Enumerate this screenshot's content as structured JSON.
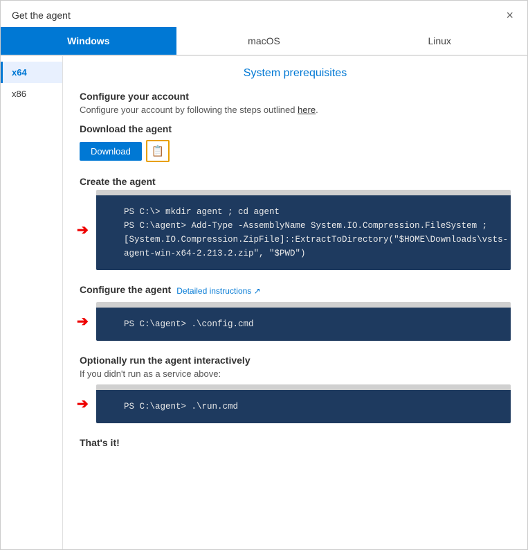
{
  "dialog": {
    "title": "Get the agent",
    "close_label": "×"
  },
  "tabs": [
    {
      "id": "windows",
      "label": "Windows",
      "active": true
    },
    {
      "id": "macos",
      "label": "macOS",
      "active": false
    },
    {
      "id": "linux",
      "label": "Linux",
      "active": false
    }
  ],
  "sidebar": {
    "items": [
      {
        "id": "x64",
        "label": "x64",
        "active": true
      },
      {
        "id": "x86",
        "label": "x86",
        "active": false
      }
    ]
  },
  "main": {
    "section_title": "System prerequisites",
    "configure_account": {
      "title": "Configure your account",
      "description": "Configure your account by following the steps outlined here."
    },
    "download_agent": {
      "title": "Download the agent",
      "download_btn": "Download",
      "copy_icon": "📋"
    },
    "create_agent": {
      "title": "Create the agent",
      "code": "PS C:\\> mkdir agent ; cd agent\nPS C:\\agent> Add-Type -AssemblyName System.IO.Compression.FileSystem ;\n[System.IO.Compression.ZipFile]::ExtractToDirectory(\"$HOME\\Downloads\\vsts-\nagent-win-x64-2.213.2.zip\", \"$PWD\")"
    },
    "configure_agent": {
      "title": "Configure the agent",
      "detailed_link": "Detailed instructions ↗",
      "code": "PS C:\\agent> .\\config.cmd"
    },
    "optional_run": {
      "title": "Optionally run the agent interactively",
      "subtitle": "If you didn't run as a service above:",
      "code": "PS C:\\agent> .\\run.cmd"
    },
    "thats_it": "That's it!"
  }
}
